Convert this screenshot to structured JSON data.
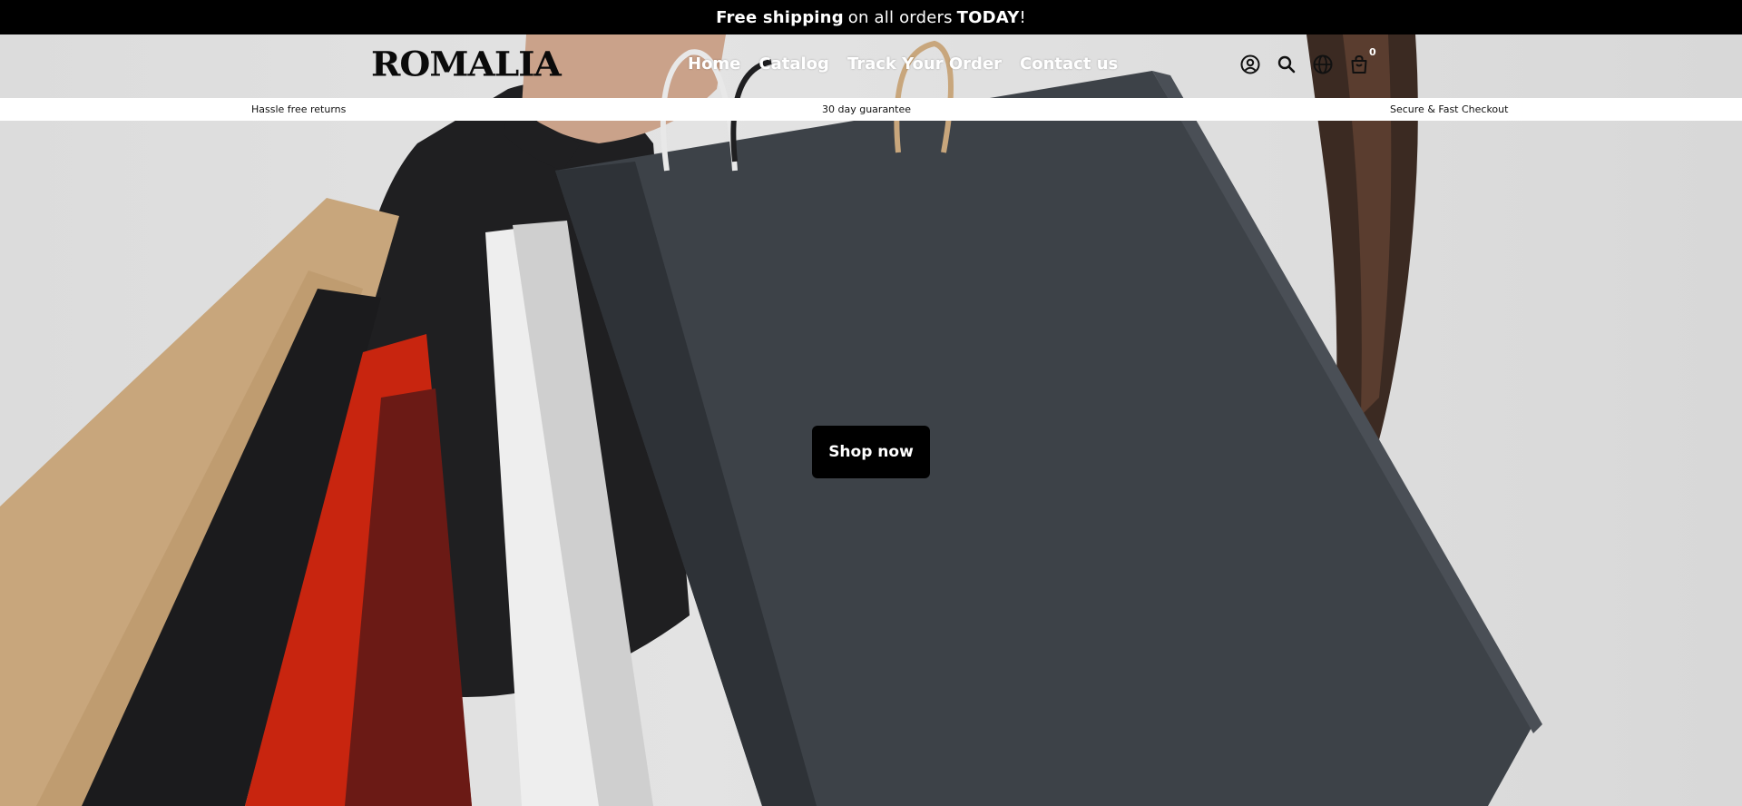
{
  "announcement": {
    "bold_1": "Free shipping",
    "regular": "on all orders",
    "bold_2": "TODAY",
    "suffix": "!"
  },
  "header": {
    "logo": "ROMALIA",
    "nav": [
      {
        "label": "Home"
      },
      {
        "label": "Catalog"
      },
      {
        "label": "Track Your Order"
      },
      {
        "label": "Contact us"
      }
    ],
    "icons": [
      "account-icon",
      "search-icon",
      "globe-icon",
      "cart-icon"
    ],
    "cart_count": "0"
  },
  "usp": {
    "item_1": "Hassle free returns",
    "item_2": "30 day guarantee",
    "item_3": "Secure & Fast Checkout"
  },
  "hero": {
    "cta_label": "Shop now"
  },
  "colors": {
    "announcement_bg": "#000000",
    "cta_bg": "#000000",
    "bag_dark": "#3d4248",
    "bag_red": "#c8250f",
    "bag_kraft": "#c8a67c"
  }
}
